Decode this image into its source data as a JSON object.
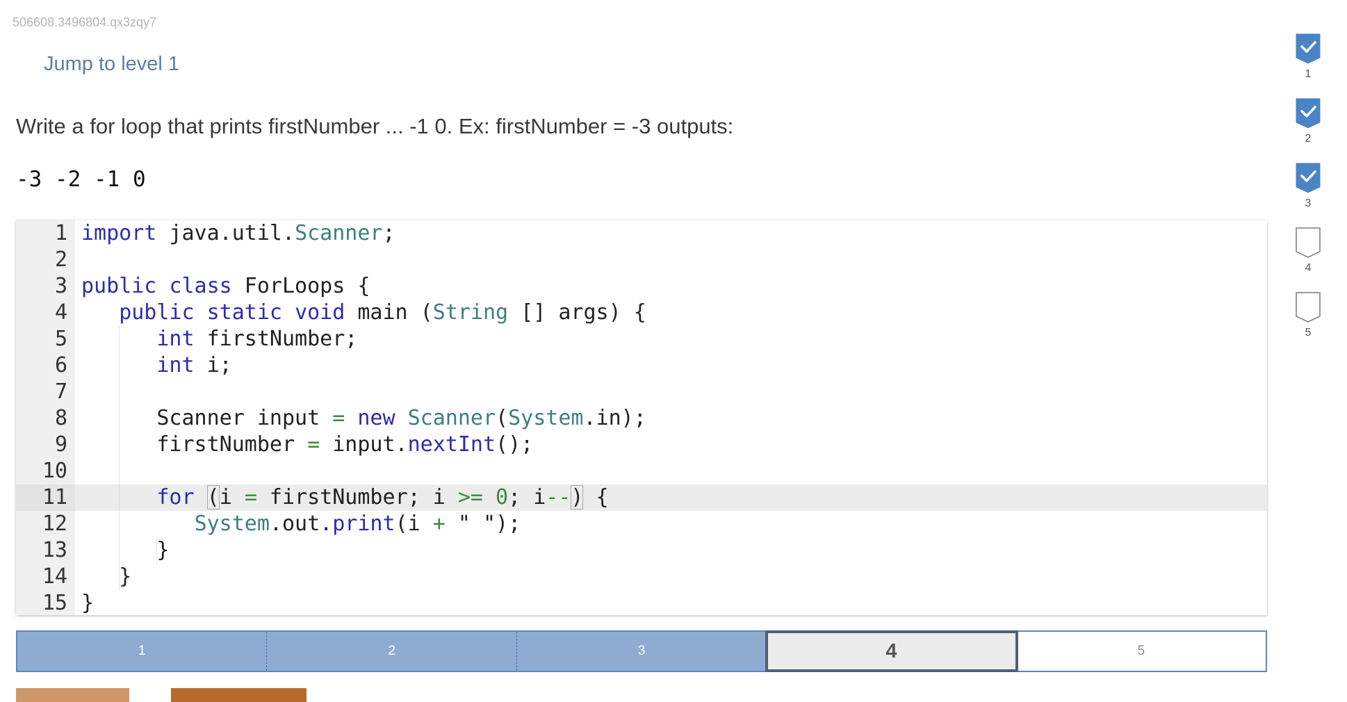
{
  "activity_id": "506608.3496804.qx3zqy7",
  "jump_link": "Jump to level 1",
  "prompt": "Write a for loop that prints firstNumber ... -1 0. Ex: firstNumber = -3 outputs:",
  "sample_output": "-3 -2 -1 0",
  "code": {
    "lines": [
      {
        "n": "1",
        "text": "import java.util.Scanner;"
      },
      {
        "n": "2",
        "text": ""
      },
      {
        "n": "3",
        "text": "public class ForLoops {"
      },
      {
        "n": "4",
        "text": "   public static void main (String [] args) {"
      },
      {
        "n": "5",
        "text": "      int firstNumber;"
      },
      {
        "n": "6",
        "text": "      int i;"
      },
      {
        "n": "7",
        "text": ""
      },
      {
        "n": "8",
        "text": "      Scanner input = new Scanner(System.in);"
      },
      {
        "n": "9",
        "text": "      firstNumber = input.nextInt();"
      },
      {
        "n": "10",
        "text": ""
      },
      {
        "n": "11",
        "text": "      for (i = firstNumber; i >= 0; i--) {"
      },
      {
        "n": "12",
        "text": "         System.out.print(i + \" \");"
      },
      {
        "n": "13",
        "text": "      }"
      },
      {
        "n": "14",
        "text": "   }"
      },
      {
        "n": "15",
        "text": "}"
      }
    ],
    "active_line": "11"
  },
  "levels": [
    {
      "label": "1",
      "state": "done"
    },
    {
      "label": "2",
      "state": "done"
    },
    {
      "label": "3",
      "state": "done"
    },
    {
      "label": "4",
      "state": "current"
    },
    {
      "label": "5",
      "state": "future"
    }
  ],
  "sidebar": [
    {
      "label": "1",
      "checked": true
    },
    {
      "label": "2",
      "checked": true
    },
    {
      "label": "3",
      "checked": true
    },
    {
      "label": "4",
      "checked": false
    },
    {
      "label": "5",
      "checked": false
    }
  ],
  "colors": {
    "accent": "#4a84c4",
    "level_done": "#8eacd2",
    "link": "#5b7fa6",
    "button_primary": "#b86a2e",
    "button_secondary": "#cf9868"
  }
}
